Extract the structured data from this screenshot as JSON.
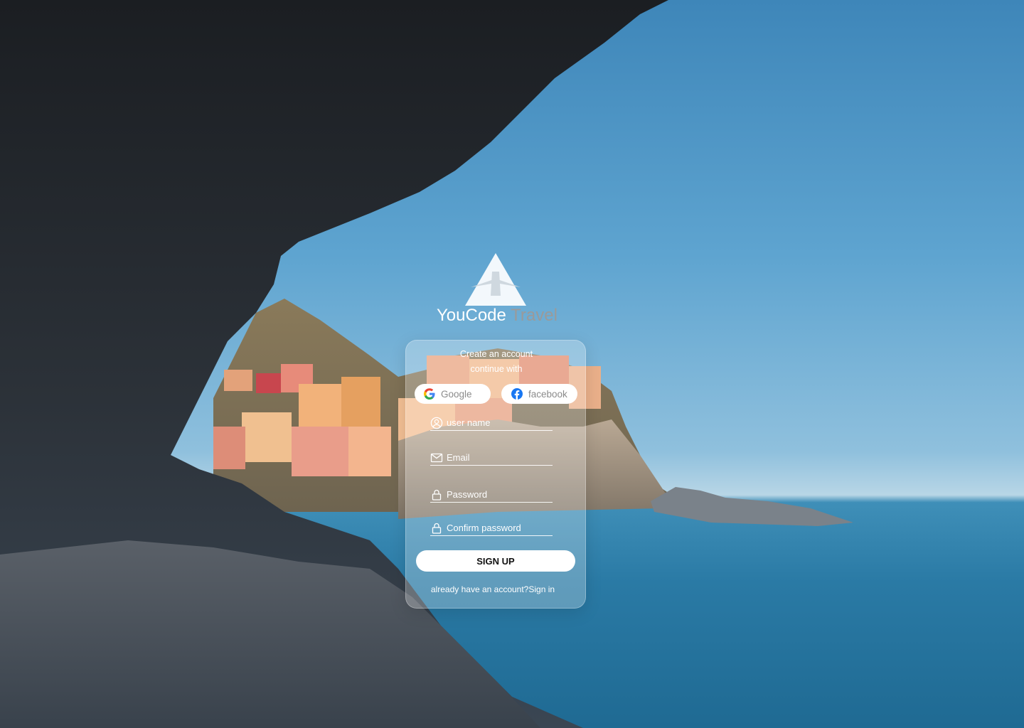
{
  "brand": {
    "name_primary": "YouCode",
    "name_accent": "Travel",
    "logo_icon": "airplane-triangle-logo"
  },
  "signup_card": {
    "title": "Create an account",
    "subtitle": "continue with",
    "social": {
      "google_label": "Google",
      "facebook_label": "facebook"
    },
    "fields": {
      "username_placeholder": "user name",
      "email_placeholder": "Email",
      "password_placeholder": "Password",
      "confirm_password_placeholder": "Confirm password"
    },
    "submit_label": "SIGN UP",
    "footer_text": "already have an account?",
    "footer_link": "Sign in"
  },
  "icons": {
    "username": "user-circle-icon",
    "email": "envelope-icon",
    "password": "lock-icon",
    "confirm_password": "lock-icon",
    "google": "google-icon",
    "facebook": "facebook-icon"
  },
  "colors": {
    "card_background": "#ffffff42",
    "button_background": "#ffffff",
    "brand_accent": "#9a9a9a",
    "facebook_blue": "#1877f2"
  }
}
